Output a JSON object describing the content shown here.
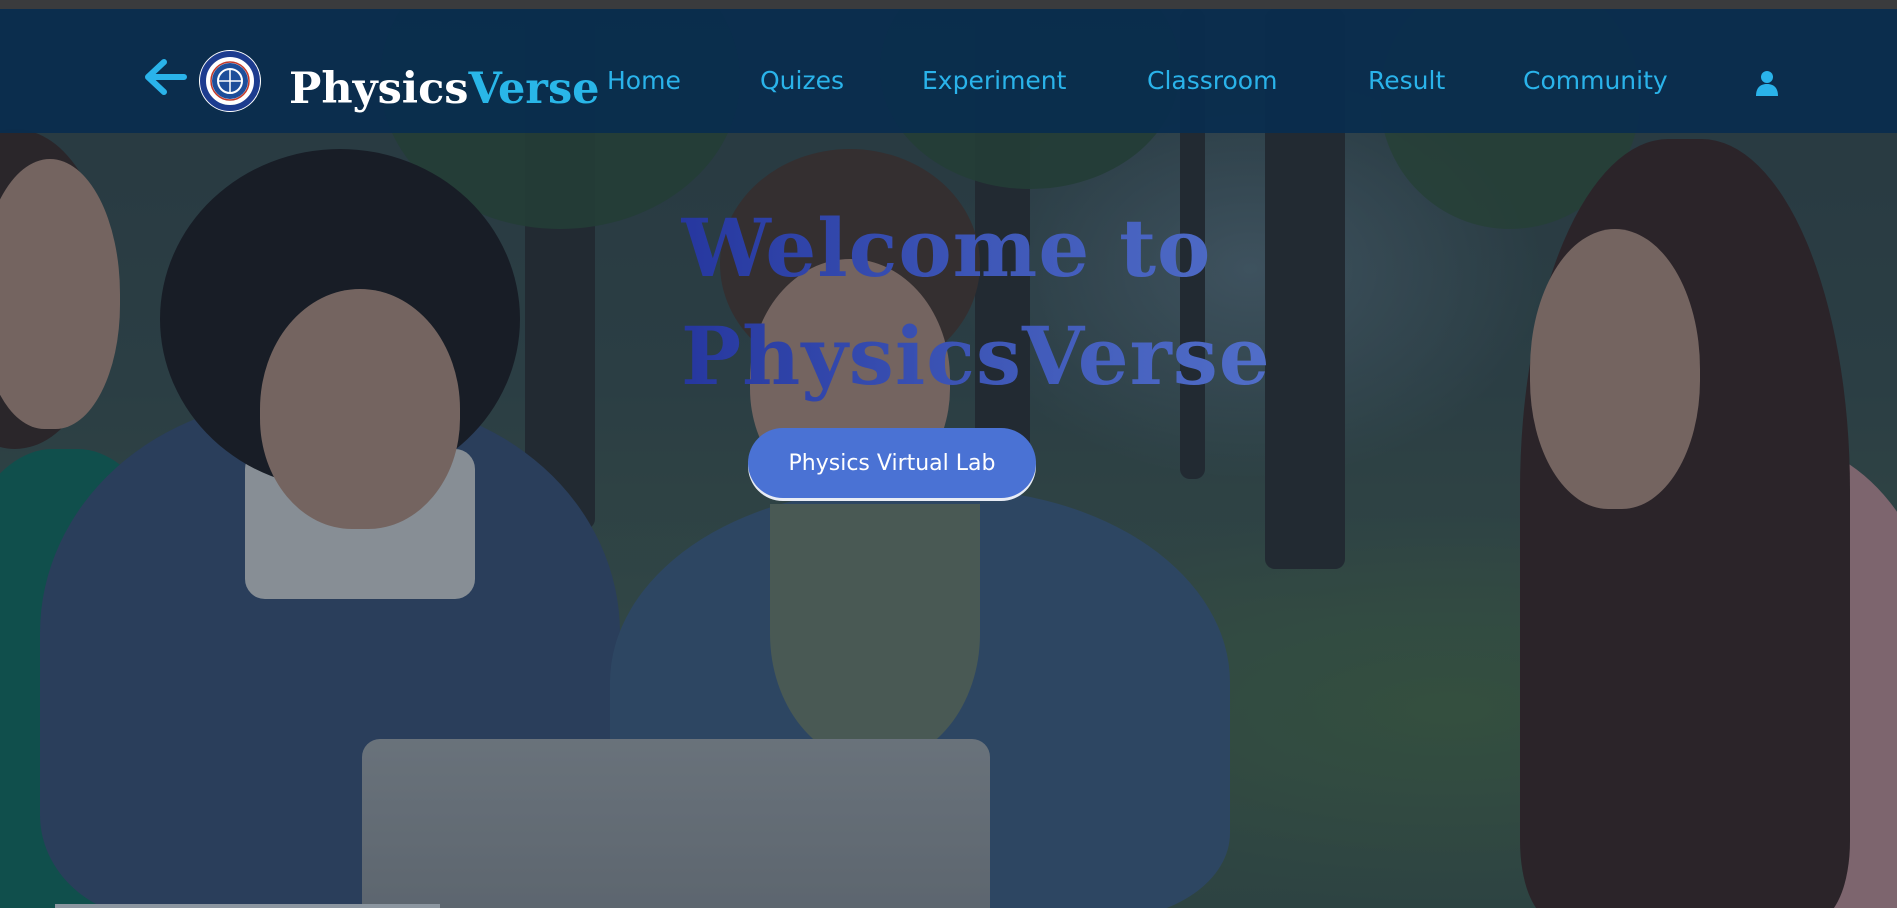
{
  "colors": {
    "navbar_bg": "#092c4e",
    "nav_link": "#2ab3ea",
    "brand_primary": "#ffffff",
    "brand_accent": "#29b6e8",
    "welcome_gradient_start": "#26379f",
    "welcome_gradient_end": "#5877cf",
    "cta_bg": "#4a72d4"
  },
  "header": {
    "back_icon": "arrow-left-icon",
    "logo_icon": "university-seal-icon",
    "brand_part1": "Physics",
    "brand_part2": "Verse",
    "nav": [
      {
        "label": "Home"
      },
      {
        "label": "Quizes"
      },
      {
        "label": "Experiment"
      },
      {
        "label": "Classroom"
      },
      {
        "label": "Result"
      },
      {
        "label": "Community"
      }
    ],
    "user_icon": "user-icon"
  },
  "hero": {
    "title_line1": "Welcome to",
    "title_line2": "PhysicsVerse",
    "cta_label": "Physics Virtual Lab"
  }
}
